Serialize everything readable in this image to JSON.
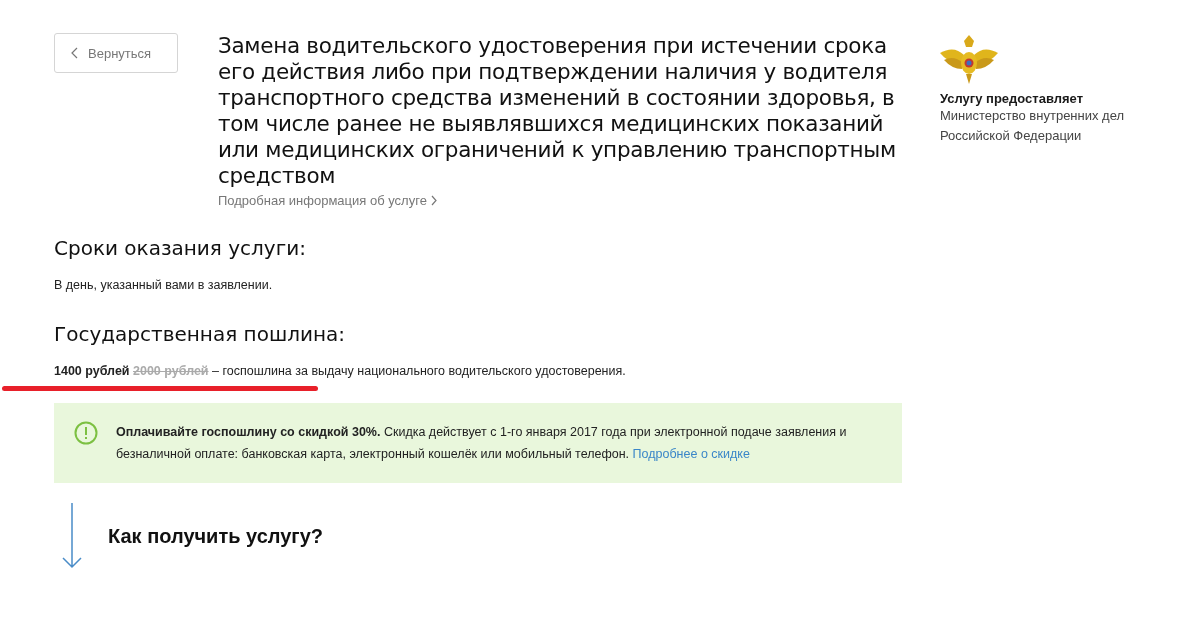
{
  "back_button": {
    "label": "Вернуться"
  },
  "service": {
    "title": "Замена водительского удостоверения при истечении срока его действия либо при подтверждении наличия у водителя транспортного средства изменений в состоянии здоровья, в том числе ранее не выявлявшихся медицинских показаний или медицинских ограничений к управлению транспортным средством",
    "details_link": "Подробная информация об услуге"
  },
  "provider": {
    "label": "Услугу предоставляет",
    "name": "Министерство внутренних дел Российской Федерации"
  },
  "terms": {
    "heading": "Сроки оказания услуги:",
    "text": "В день, указанный вами в заявлении."
  },
  "fee": {
    "heading": "Государственная пошлина:",
    "price": "1400 рублей",
    "old_price": "2000 рублей",
    "text": "– госпошлина за выдачу национального водительского удостоверения.",
    "underlined": true
  },
  "notice": {
    "text": "**Оплачивайте госпошлину со скидкой 30%.** Скидка действует с 1-го января 2017 года при электронной подаче заявления и безналичной оплате: банковская карта, электронный кошелёк или мобильный телефон.",
    "link": "Подробнее о скидке"
  },
  "next_section": {
    "heading": "Как получить услугу?"
  }
}
